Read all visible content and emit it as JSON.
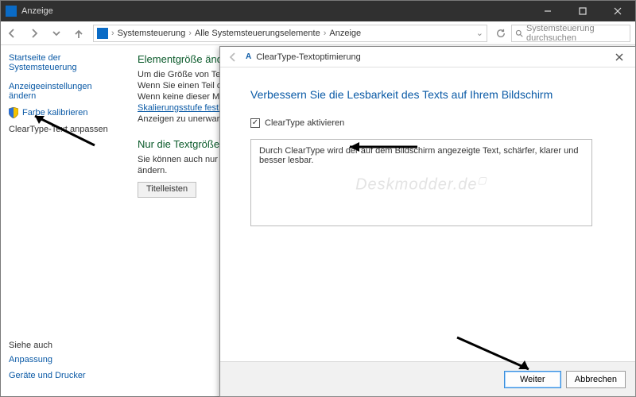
{
  "main_window": {
    "title": "Anzeige",
    "breadcrumb": {
      "root": "Systemsteuerung",
      "mid": "Alle Systemsteuerungselemente",
      "leaf": "Anzeige"
    },
    "search_placeholder": "Systemsteuerung durchsuchen",
    "help_badge": "?"
  },
  "sidebar": {
    "home": "Startseite der Systemsteuerung",
    "items": [
      {
        "label": "Anzeigeeinstellungen ändern"
      },
      {
        "label": "Farbe kalibrieren",
        "shield": true
      },
      {
        "label": "ClearType-Text anpassen"
      }
    ],
    "see_also_hdr": "Siehe auch",
    "see_also": [
      "Anpassung",
      "Geräte und Drucker"
    ]
  },
  "content": {
    "h1": "Elementgröße ändern",
    "p1": "Um die Größe von Text, Apps und anderen Elementen zu ändern, verwenden Sie diese Anzeigeeinstellungen.",
    "p2": "Wenn Sie einen Teil des",
    "p3": "Wenn keine dieser M",
    "link": "Skalierungsstufe festl",
    "p4": "Anzeigen zu unerwart",
    "h2": "Nur die Textgröße",
    "p5": "Sie können auch nur",
    "p6": "ändern.",
    "dropdown": "Titelleisten"
  },
  "wizard": {
    "title": "ClearType-Textoptimierung",
    "heading": "Verbessern Sie die Lesbarkeit des Texts auf Ihrem Bildschirm",
    "checkbox_label": "ClearType aktivieren",
    "checkbox_checked": true,
    "description": "Durch ClearType wird der auf dem Bildschirm angezeigte Text, schärfer, klarer und besser lesbar.",
    "watermark": "Deskmodder.de",
    "next": "Weiter",
    "cancel": "Abbrechen"
  }
}
